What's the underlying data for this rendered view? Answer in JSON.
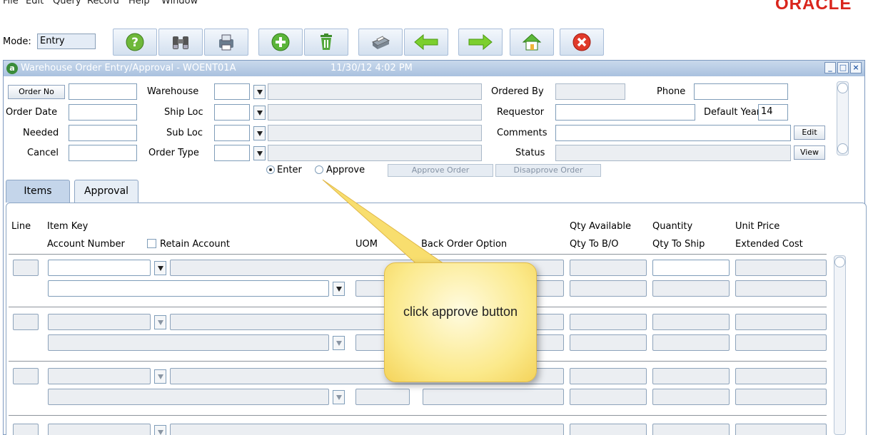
{
  "menu": {
    "items": [
      "File",
      "Edit",
      "Query",
      "Record",
      "Help",
      "Window"
    ],
    "logo": "ORACLE"
  },
  "toolbar": {
    "mode_label": "Mode:",
    "mode_value": "Entry",
    "buttons": [
      "help-icon",
      "binoculars-icon",
      "print-icon",
      "add-icon",
      "delete-icon",
      "printer-icon",
      "back-arrow-icon",
      "forward-arrow-icon",
      "home-icon",
      "close-icon"
    ]
  },
  "window": {
    "title": "Warehouse Order Entry/Approval - WOENT01A",
    "datetime": "11/30/12  4:02 PM"
  },
  "header": {
    "order_no_button": "Order No",
    "order_date": "Order Date",
    "needed": "Needed",
    "cancel": "Cancel",
    "warehouse": "Warehouse",
    "ship_loc": "Ship Loc",
    "sub_loc": "Sub Loc",
    "order_type": "Order Type",
    "ordered_by": "Ordered By",
    "requestor": "Requestor",
    "comments": "Comments",
    "status": "Status",
    "phone": "Phone",
    "default_year": "Default Year",
    "default_year_value": "14",
    "edit_button": "Edit",
    "view_button": "View",
    "radio_enter": "Enter",
    "radio_approve": "Approve",
    "approve_order_button": "Approve Order",
    "disapprove_order_button": "Disapprove Order"
  },
  "tabs": {
    "items": "Items",
    "approval": "Approval"
  },
  "columns": {
    "line": "Line",
    "item_key": "Item Key",
    "account_number": "Account Number",
    "retain_account": "Retain Account",
    "uom": "UOM",
    "back_order_option": "Back Order Option",
    "qty_available": "Qty Available",
    "qty_to_bo": "Qty To B/O",
    "quantity": "Quantity",
    "qty_to_ship": "Qty To Ship",
    "unit_price": "Unit Price",
    "extended_cost": "Extended Cost"
  },
  "callout": {
    "text": "click approve button"
  }
}
